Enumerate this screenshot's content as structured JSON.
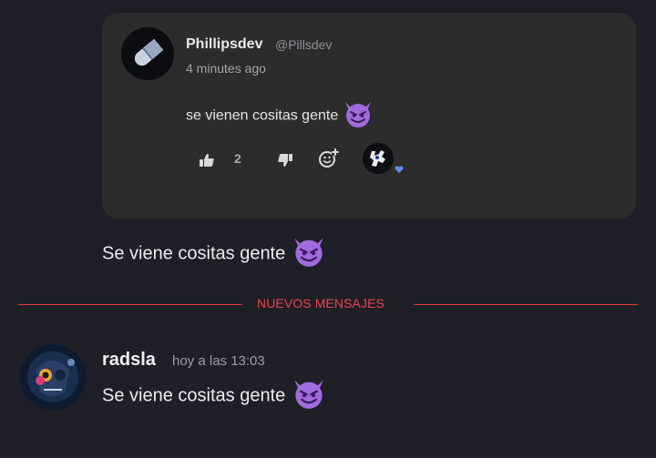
{
  "quoted_post": {
    "author_name": "Phillipsdev",
    "author_handle": "@Pillsdev",
    "timestamp": "4 minutes ago",
    "text": "se vienen cositas gente",
    "emoji": "smiling-imp",
    "like_count": "2"
  },
  "forward_message": {
    "text": "Se viene cositas gente",
    "emoji": "smiling-imp"
  },
  "divider": {
    "label": "NUEVOS MENSAJES"
  },
  "message": {
    "author": "radsla",
    "timestamp": "hoy a las 13:03",
    "text": "Se viene cositas gente",
    "emoji": "smiling-imp"
  },
  "colors": {
    "background": "#1e1f27",
    "card": "#2c2c2d",
    "new_messages": "#f0434a",
    "emoji_purple": "#a06bdc",
    "heart": "#5b8def"
  }
}
